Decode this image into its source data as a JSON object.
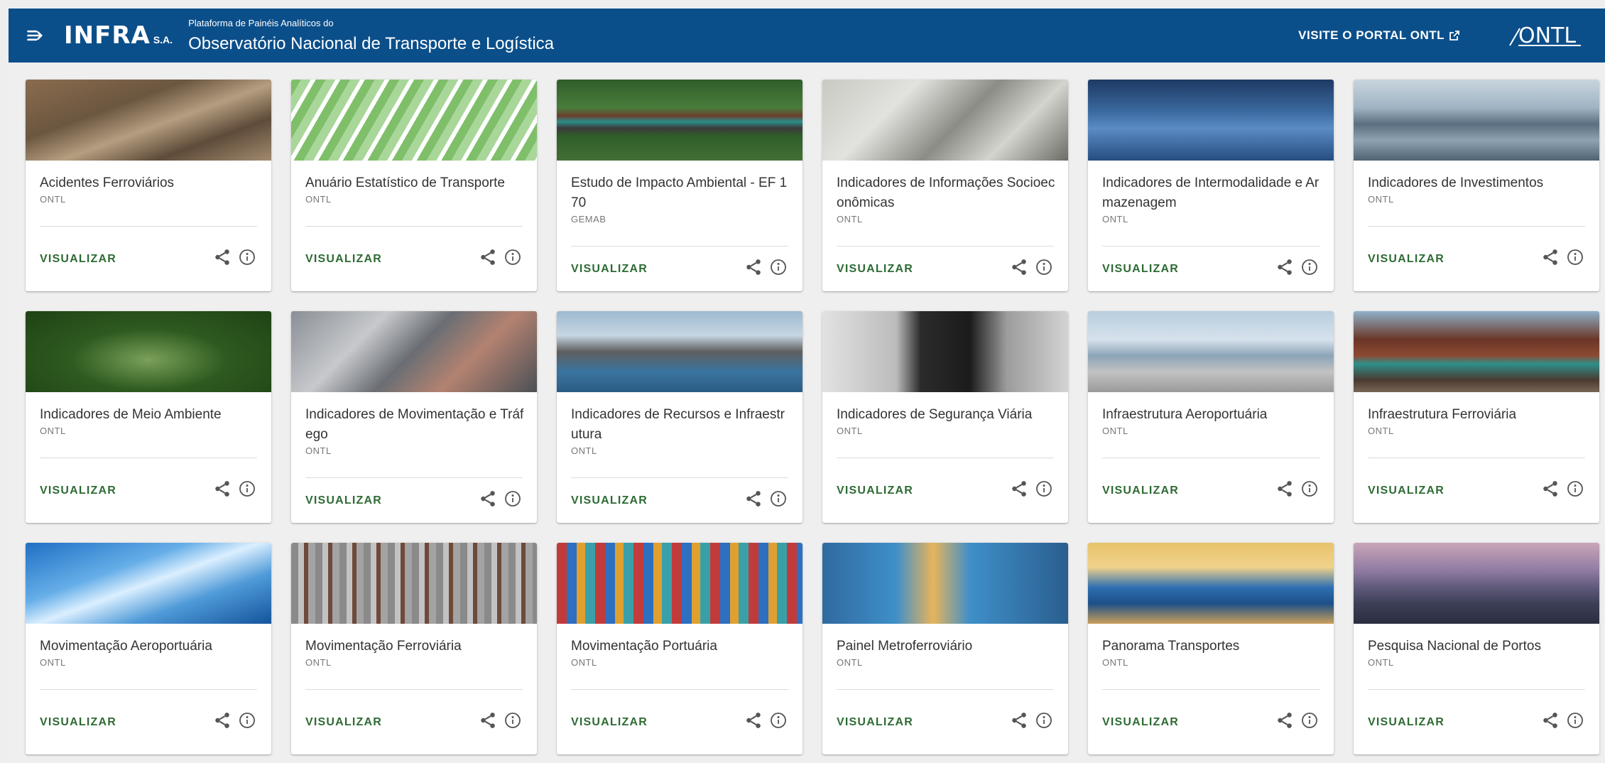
{
  "header": {
    "brand": "INFRA",
    "brand_suffix": "S.A.",
    "subtitle": "Plataforma de Painéis Analíticos do",
    "title": "Observatório Nacional de Transporte e Logística",
    "portal_link": "VISITE O PORTAL ONTL",
    "ontl_logo": "ONTL",
    "colors": {
      "bar": "#0b4f8a",
      "text": "#ffffff"
    }
  },
  "cards": [
    {
      "title": "Acidentes Ferroviários",
      "org": "ONTL",
      "action": "VISUALIZAR"
    },
    {
      "title": "Anuário Estatístico de Transporte",
      "org": "ONTL",
      "action": "VISUALIZAR"
    },
    {
      "title": "Estudo de Impacto Ambiental - EF 170",
      "org": "GEMAB",
      "action": "VISUALIZAR"
    },
    {
      "title": "Indicadores de Informações Socioeconômicas",
      "org": "ONTL",
      "action": "VISUALIZAR"
    },
    {
      "title": "Indicadores de Intermodalidade e Armazenagem",
      "org": "ONTL",
      "action": "VISUALIZAR"
    },
    {
      "title": "Indicadores de Investimentos",
      "org": "ONTL",
      "action": "VISUALIZAR"
    },
    {
      "title": "Indicadores de Meio Ambiente",
      "org": "ONTL",
      "action": "VISUALIZAR"
    },
    {
      "title": "Indicadores de Movimentação e Tráfego",
      "org": "ONTL",
      "action": "VISUALIZAR"
    },
    {
      "title": "Indicadores de Recursos e Infraestrutura",
      "org": "ONTL",
      "action": "VISUALIZAR"
    },
    {
      "title": "Indicadores de Segurança Viária",
      "org": "ONTL",
      "action": "VISUALIZAR"
    },
    {
      "title": "Infraestrutura Aeroportuária",
      "org": "ONTL",
      "action": "VISUALIZAR"
    },
    {
      "title": "Infraestrutura Ferroviária",
      "org": "ONTL",
      "action": "VISUALIZAR"
    },
    {
      "title": "Movimentação Aeroportuária",
      "org": "ONTL",
      "action": "VISUALIZAR"
    },
    {
      "title": "Movimentação Ferroviária",
      "org": "ONTL",
      "action": "VISUALIZAR"
    },
    {
      "title": "Movimentação Portuária",
      "org": "ONTL",
      "action": "VISUALIZAR"
    },
    {
      "title": "Painel Metroferroviário",
      "org": "ONTL",
      "action": "VISUALIZAR"
    },
    {
      "title": "Panorama Transportes",
      "org": "ONTL",
      "action": "VISUALIZAR"
    },
    {
      "title": "Pesquisa Nacional de Portos",
      "org": "ONTL",
      "action": "VISUALIZAR"
    }
  ],
  "icons": {
    "menu": "menu-open-icon",
    "external": "external-link-icon",
    "share": "share-icon",
    "info": "info-icon"
  },
  "colors": {
    "action_green": "#2e6b34",
    "page_bg": "#eeeeee"
  }
}
